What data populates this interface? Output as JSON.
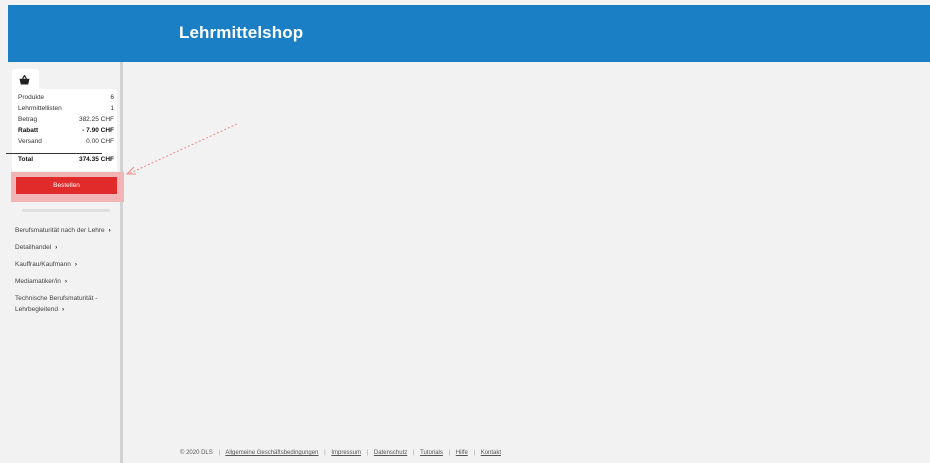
{
  "header": {
    "title": "Lehrmittelshop"
  },
  "cart": {
    "rows": [
      {
        "label": "Produkte",
        "value": "6"
      },
      {
        "label": "Lehrmittellisten",
        "value": "1"
      },
      {
        "label": "Betrag",
        "value": "382.25 CHF"
      },
      {
        "label": "Rabatt",
        "value": "- 7.90 CHF"
      },
      {
        "label": "Versand",
        "value": "0.00 CHF"
      }
    ],
    "total": {
      "label": "Total",
      "value": "374.35 CHF"
    },
    "order_label": "Bestellen"
  },
  "nav": {
    "items": [
      {
        "label": "Berufsmaturität nach der Lehre"
      },
      {
        "label": "Detailhandel"
      },
      {
        "label": "Kauffrau/Kaufmann"
      },
      {
        "label": "Mediamatiker/in"
      },
      {
        "label": "Technische Berufsmaturität - Lehrbegleitend"
      }
    ],
    "chevron": "›"
  },
  "footer": {
    "copyright": "© 2020 DLS",
    "links": [
      "Allgemeine Geschäftsbedingungen",
      "Impressum",
      "Datenschutz",
      "Tutorials",
      "Hilfe",
      "Kontakt"
    ],
    "separator": "|"
  },
  "colors": {
    "header": "#1b7fc5",
    "order_button": "#e12b2b",
    "highlight": "#f2b5b5"
  },
  "icons": {
    "cart": "basket-icon"
  }
}
